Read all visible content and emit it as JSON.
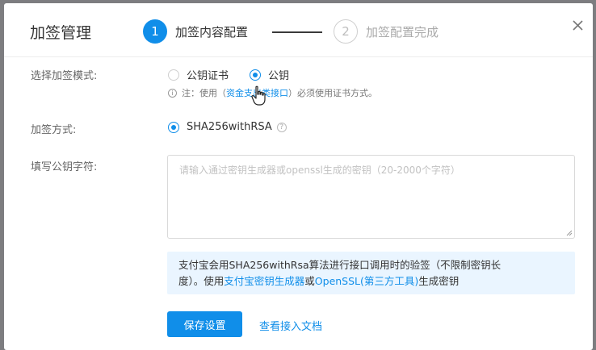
{
  "dialog": {
    "title": "加签管理",
    "steps": [
      {
        "number": "1",
        "label": "加签内容配置"
      },
      {
        "number": "2",
        "label": "加签配置完成"
      }
    ],
    "close_icon": "close-icon"
  },
  "form": {
    "mode_label": "选择加签模式:",
    "mode_options": [
      "公钥证书",
      "公钥"
    ],
    "mode_selected": "公钥",
    "note_prefix": "注：使用（",
    "note_link": "资金支出类接口",
    "note_suffix": "）必须使用证书方式。",
    "method_label": "加签方式:",
    "method_option": "SHA256withRSA",
    "key_label": "填写公钥字符:",
    "key_placeholder": "请输入通过密钥生成器或openssl生成的密钥（20-2000个字符）",
    "key_value": ""
  },
  "tip": {
    "line1": "支付宝会用SHA256withRsa算法进行接口调用时的验签（不限制密钥长",
    "line2_prefix": "度）。使用",
    "link1": "支付宝密钥生成器",
    "middle": "或",
    "link2": "OpenSSL(第三方工具)",
    "suffix": "生成密钥"
  },
  "actions": {
    "save_label": "保存设置",
    "doc_label": "查看接入文档"
  },
  "colors": {
    "accent": "#108ee9",
    "tip_bg": "#eaf5ff",
    "overlay": "#7d7d80"
  }
}
